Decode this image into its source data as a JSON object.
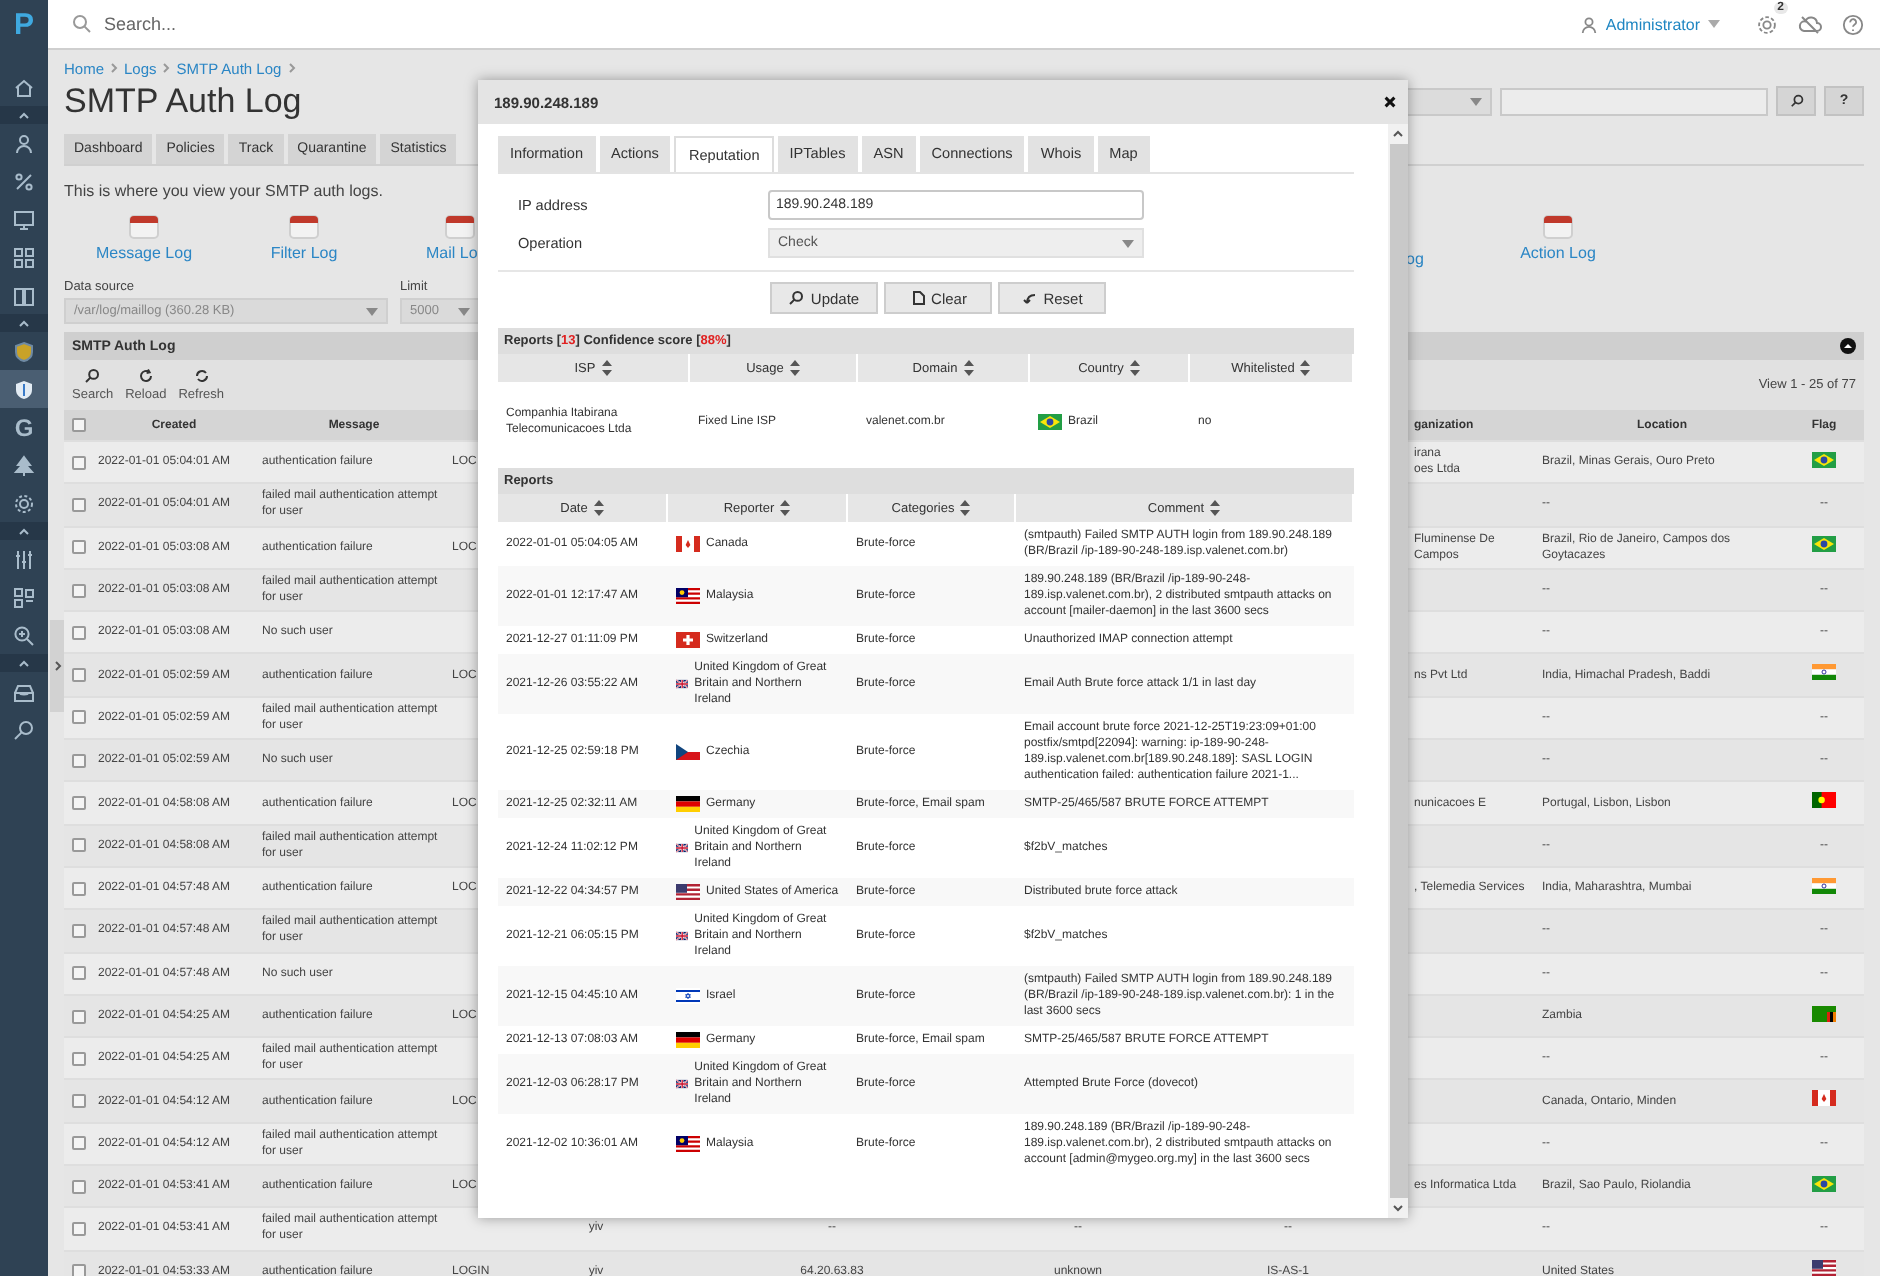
{
  "sidebar": {
    "logo": "P",
    "items": [
      {
        "kind": "home",
        "selected": false
      },
      {
        "kind": "section",
        "selected": false
      },
      {
        "kind": "user",
        "selected": false
      },
      {
        "kind": "percent",
        "selected": false
      },
      {
        "kind": "monitor",
        "selected": false
      },
      {
        "kind": "grid",
        "selected": false
      },
      {
        "kind": "book",
        "selected": false
      },
      {
        "kind": "section",
        "selected": false
      },
      {
        "kind": "badge",
        "selected": false
      },
      {
        "kind": "shield",
        "selected": true
      },
      {
        "kind": "letter",
        "text": "G",
        "selected": false
      },
      {
        "kind": "tree",
        "selected": false
      },
      {
        "kind": "gear",
        "selected": false
      },
      {
        "kind": "section",
        "selected": false
      },
      {
        "kind": "sliders",
        "selected": false
      },
      {
        "kind": "apps",
        "selected": false
      },
      {
        "kind": "zoom",
        "selected": false
      },
      {
        "kind": "section",
        "selected": false
      },
      {
        "kind": "tray",
        "selected": false
      },
      {
        "kind": "search",
        "selected": false
      }
    ]
  },
  "topbar": {
    "search": {
      "placeholder": "Search..."
    },
    "user": "Administrator",
    "notifications": "2"
  },
  "page": {
    "breadcrumb": [
      "Home",
      "Logs",
      "SMTP Auth Log"
    ],
    "title": "SMTP Auth Log",
    "help_label": "?",
    "tabs": [
      {
        "label": "Dashboard",
        "selected": false
      },
      {
        "label": "Policies",
        "selected": false
      },
      {
        "label": "Track",
        "selected": false
      },
      {
        "label": "Quarantine",
        "selected": false
      },
      {
        "label": "Statistics",
        "selected": false
      }
    ],
    "description": "This is where you view your SMTP auth logs.",
    "log_links": [
      {
        "label": "Message Log",
        "icon": true
      },
      {
        "label": "Filter Log",
        "icon": true
      },
      {
        "label": "Mail Lo",
        "icon": true
      },
      {
        "label": "og",
        "icon": false
      },
      {
        "label": "Action Log",
        "icon": true
      }
    ],
    "data_source": {
      "label": "Data source",
      "value": "/var/log/maillog (360.28 KB)"
    },
    "limit": {
      "label": "Limit",
      "value": "5000"
    },
    "panel": {
      "title": "SMTP Auth Log",
      "toolbar": [
        {
          "kind": "search",
          "label": "Search"
        },
        {
          "kind": "reload",
          "label": "Reload"
        },
        {
          "kind": "refresh",
          "label": "Refresh"
        }
      ],
      "pager": "View 1 - 25 of 77",
      "select_all_checked": false,
      "columns": {
        "created": "Created",
        "message": "Message",
        "organization": "ganization",
        "location": "Location",
        "flag": "Flag"
      },
      "rows": [
        {
          "checked": false,
          "created": "2022-01-01 05:04:01 AM",
          "message": "authentication failure",
          "column_3": "LOC",
          "organization": "irana\noes Ltda",
          "location": "Brazil, Minas Gerais, Ouro Preto",
          "flag": {
            "kind": "br"
          }
        },
        {
          "checked": false,
          "created": "2022-01-01 05:04:01 AM",
          "message": "failed mail authentication attempt for user",
          "location": "--",
          "flag_text": "--"
        },
        {
          "checked": false,
          "created": "2022-01-01 05:03:08 AM",
          "message": "authentication failure",
          "column_3": "LOC",
          "organization": "Fluminense De Campos",
          "location": "Brazil, Rio de Janeiro, Campos dos Goytacazes",
          "flag": {
            "kind": "br"
          }
        },
        {
          "checked": false,
          "created": "2022-01-01 05:03:08 AM",
          "message": "failed mail authentication attempt for user",
          "location": "--",
          "flag_text": "--"
        },
        {
          "checked": false,
          "created": "2022-01-01 05:03:08 AM",
          "message": "No such user",
          "location": "--",
          "flag_text": "--"
        },
        {
          "checked": false,
          "created": "2022-01-01 05:02:59 AM",
          "message": "authentication failure",
          "column_3": "LOC",
          "organization": "ns Pvt Ltd",
          "location": "India, Himachal Pradesh, Baddi",
          "flag": {
            "kind": "in"
          }
        },
        {
          "checked": false,
          "created": "2022-01-01 05:02:59 AM",
          "message": "failed mail authentication attempt for user",
          "location": "--",
          "flag_text": "--"
        },
        {
          "checked": false,
          "created": "2022-01-01 05:02:59 AM",
          "message": "No such user",
          "location": "--",
          "flag_text": "--"
        },
        {
          "checked": false,
          "created": "2022-01-01 04:58:08 AM",
          "message": "authentication failure",
          "column_3": "LOC",
          "organization": "nunicacoes E",
          "location": "Portugal, Lisbon, Lisbon",
          "flag": {
            "kind": "pt"
          }
        },
        {
          "checked": false,
          "created": "2022-01-01 04:58:08 AM",
          "message": "failed mail authentication attempt for user",
          "location": "--",
          "flag_text": "--"
        },
        {
          "checked": false,
          "created": "2022-01-01 04:57:48 AM",
          "message": "authentication failure",
          "column_3": "LOC",
          "organization": ", Telemedia Services",
          "location": "India, Maharashtra, Mumbai",
          "flag": {
            "kind": "in"
          }
        },
        {
          "checked": false,
          "created": "2022-01-01 04:57:48 AM",
          "message": "failed mail authentication attempt for user",
          "location": "--",
          "flag_text": "--"
        },
        {
          "checked": false,
          "created": "2022-01-01 04:57:48 AM",
          "message": "No such user",
          "location": "--",
          "flag_text": "--"
        },
        {
          "checked": false,
          "created": "2022-01-01 04:54:25 AM",
          "message": "authentication failure",
          "column_3": "LOC",
          "location": "Zambia",
          "flag": {
            "kind": "zm"
          }
        },
        {
          "checked": false,
          "created": "2022-01-01 04:54:25 AM",
          "message": "failed mail authentication attempt for user",
          "location": "--",
          "flag_text": "--"
        },
        {
          "checked": false,
          "created": "2022-01-01 04:54:12 AM",
          "message": "authentication failure",
          "column_3": "LOC",
          "location": "Canada, Ontario, Minden",
          "flag": {
            "kind": "ca"
          }
        },
        {
          "checked": false,
          "created": "2022-01-01 04:54:12 AM",
          "message": "failed mail authentication attempt for user",
          "location": "--",
          "flag_text": "--"
        },
        {
          "checked": false,
          "created": "2022-01-01 04:53:41 AM",
          "message": "authentication failure",
          "column_3": "LOC",
          "organization": "es Informatica Ltda",
          "location": "Brazil, Sao Paulo, Riolandia",
          "flag": {
            "kind": "br"
          }
        },
        {
          "checked": false,
          "created": "2022-01-01 04:53:41 AM",
          "message": "failed mail authentication attempt for user",
          "column_4": "yiv",
          "column_5": "--",
          "column_6": "--",
          "column_7": "--",
          "location": "--",
          "flag_text": "--"
        },
        {
          "checked": false,
          "created": "2022-01-01 04:53:33 AM",
          "message": "authentication failure",
          "column_3": "LOGIN",
          "column_4": "yiv",
          "column_5": "64.20.63.83",
          "column_6": "unknown",
          "column_7": "IS-AS-1",
          "location": "United States",
          "flag": {
            "kind": "us"
          }
        }
      ]
    }
  },
  "modal": {
    "title": "189.90.248.189",
    "tabs": [
      {
        "label": "Information",
        "selected": false
      },
      {
        "label": "Actions",
        "selected": false
      },
      {
        "label": "Reputation",
        "selected": true
      },
      {
        "label": "IPTables",
        "selected": false
      },
      {
        "label": "ASN",
        "selected": false
      },
      {
        "label": "Connections",
        "selected": false
      },
      {
        "label": "Whois",
        "selected": false
      },
      {
        "label": "Map",
        "selected": false
      }
    ],
    "form": {
      "ip_label": "IP address",
      "ip_value": "189.90.248.189",
      "operation_label": "Operation",
      "operation_value": "Check"
    },
    "buttons": [
      {
        "kind": "update",
        "label": "Update"
      },
      {
        "kind": "clear",
        "label": "Clear"
      },
      {
        "kind": "reset",
        "label": "Reset"
      }
    ],
    "reputation": {
      "title_parts": [
        {
          "text": "Reports [",
          "highlight": false
        },
        {
          "text": "13",
          "highlight": true
        },
        {
          "text": "] Confidence score [",
          "highlight": false
        },
        {
          "text": "88%",
          "highlight": true
        },
        {
          "text": "]",
          "highlight": false
        }
      ],
      "columns": [
        "ISP",
        "Usage",
        "Domain",
        "Country",
        "Whitelisted"
      ],
      "rows": [
        {
          "isp": "Companhia Itabirana Telecomunicacoes Ltda",
          "usage": "Fixed Line ISP",
          "domain": "valenet.com.br",
          "flag": {
            "kind": "br"
          },
          "country": "Brazil",
          "whitelisted": "no"
        }
      ]
    },
    "reports": {
      "title": "Reports",
      "columns": [
        "Date",
        "Reporter",
        "Categories",
        "Comment"
      ],
      "rows": [
        {
          "date": "2022-01-01 05:04:05 AM",
          "flag": {
            "kind": "ca"
          },
          "reporter": "Canada",
          "categories": "Brute-force",
          "comment": "(smtpauth) Failed SMTP AUTH login from 189.90.248.189 (BR/Brazil /ip-189-90-248-189.isp.valenet.com.br)"
        },
        {
          "date": "2022-01-01 12:17:47 AM",
          "flag": {
            "kind": "my"
          },
          "reporter": "Malaysia",
          "categories": "Brute-force",
          "comment": "189.90.248.189 (BR/Brazil /ip-189-90-248-189.isp.valenet.com.br), 2 distributed smtpauth attacks on account [mailer-daemon] in the last 3600 secs"
        },
        {
          "date": "2021-12-27 01:11:09 PM",
          "flag": {
            "kind": "ch"
          },
          "reporter": "Switzerland",
          "categories": "Brute-force",
          "comment": "Unauthorized IMAP connection attempt"
        },
        {
          "date": "2021-12-26 03:55:22 AM",
          "flag": {
            "kind": "gb"
          },
          "reporter": "United Kingdom of Great Britain and Northern Ireland",
          "categories": "Brute-force",
          "comment": "Email Auth Brute force attack 1/1 in last day"
        },
        {
          "date": "2021-12-25 02:59:18 PM",
          "flag": {
            "kind": "cz"
          },
          "reporter": "Czechia",
          "categories": "Brute-force",
          "comment": "Email account brute force 2021-12-25T19:23:09+01:00 postfix/smtpd[22094]: warning: ip-189-90-248-189.isp.valenet.com.br[189.90.248.189]: SASL LOGIN authentication failed: authentication failure 2021-1..."
        },
        {
          "date": "2021-12-25 02:32:11 AM",
          "flag": {
            "kind": "de"
          },
          "reporter": "Germany",
          "categories": "Brute-force, Email spam",
          "comment": "SMTP-25/465/587 BRUTE FORCE ATTEMPT"
        },
        {
          "date": "2021-12-24 11:02:12 PM",
          "flag": {
            "kind": "gb"
          },
          "reporter": "United Kingdom of Great Britain and Northern Ireland",
          "categories": "Brute-force",
          "comment": "$f2bV_matches"
        },
        {
          "date": "2021-12-22 04:34:57 PM",
          "flag": {
            "kind": "us"
          },
          "reporter": "United States of America",
          "categories": "Brute-force",
          "comment": "Distributed brute force attack"
        },
        {
          "date": "2021-12-21 06:05:15 PM",
          "flag": {
            "kind": "gb"
          },
          "reporter": "United Kingdom of Great Britain and Northern Ireland",
          "categories": "Brute-force",
          "comment": "$f2bV_matches"
        },
        {
          "date": "2021-12-15 04:45:10 AM",
          "flag": {
            "kind": "il"
          },
          "reporter": "Israel",
          "categories": "Brute-force",
          "comment": "(smtpauth) Failed SMTP AUTH login from 189.90.248.189 (BR/Brazil /ip-189-90-248-189.isp.valenet.com.br): 1 in the last 3600 secs"
        },
        {
          "date": "2021-12-13 07:08:03 AM",
          "flag": {
            "kind": "de"
          },
          "reporter": "Germany",
          "categories": "Brute-force, Email spam",
          "comment": "SMTP-25/465/587 BRUTE FORCE ATTEMPT"
        },
        {
          "date": "2021-12-03 06:28:17 PM",
          "flag": {
            "kind": "gb"
          },
          "reporter": "United Kingdom of Great Britain and Northern Ireland",
          "categories": "Brute-force",
          "comment": "Attempted Brute Force (dovecot)"
        },
        {
          "date": "2021-12-02 10:36:01 AM",
          "flag": {
            "kind": "my"
          },
          "reporter": "Malaysia",
          "categories": "Brute-force",
          "comment": "189.90.248.189 (BR/Brazil /ip-189-90-248-189.isp.valenet.com.br), 2 distributed smtpauth attacks on account [admin@mygeo.org.my] in the last 3600 secs"
        }
      ]
    }
  }
}
